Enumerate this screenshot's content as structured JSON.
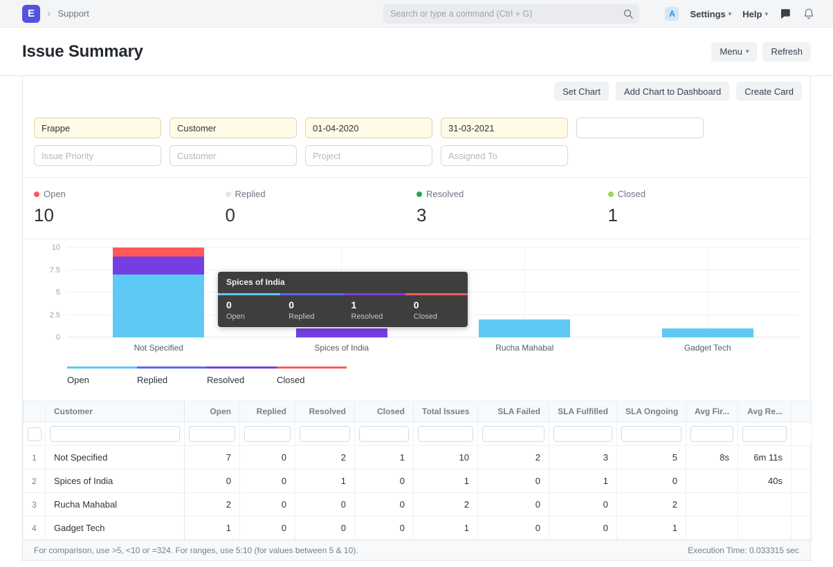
{
  "navbar": {
    "logo_letter": "E",
    "breadcrumb": "Support",
    "search_placeholder": "Search or type a command (Ctrl + G)",
    "shortcut_letter": "A",
    "settings_label": "Settings",
    "help_label": "Help"
  },
  "icons": {
    "chevron_right": "›",
    "caret_down": "▾"
  },
  "page": {
    "title": "Issue Summary",
    "menu_label": "Menu",
    "refresh_label": "Refresh"
  },
  "actions": {
    "set_chart": "Set Chart",
    "add_chart_to_dashboard": "Add Chart to Dashboard",
    "create_card": "Create Card"
  },
  "filters": {
    "row1": [
      {
        "value": "Frappe"
      },
      {
        "value": "Customer"
      },
      {
        "value": "01-04-2020"
      },
      {
        "value": "31-03-2021"
      },
      {
        "value": ""
      }
    ],
    "row2_placeholders": [
      "Issue Priority",
      "Customer",
      "Project",
      "Assigned To"
    ]
  },
  "stats": [
    {
      "label": "Open",
      "value": "10",
      "color": "#ff5858"
    },
    {
      "label": "Replied",
      "value": "0",
      "color": "#dce6ef"
    },
    {
      "label": "Resolved",
      "value": "3",
      "color": "#28a745"
    },
    {
      "label": "Closed",
      "value": "1",
      "color": "#98d85b"
    }
  ],
  "chart_data": {
    "type": "bar",
    "stacked": true,
    "categories": [
      "Not Specified",
      "Spices of India",
      "Rucha Mahabal",
      "Gadget Tech"
    ],
    "series": [
      {
        "name": "Open",
        "color": "#5ec9f5",
        "values": [
          7,
          0,
          2,
          1
        ]
      },
      {
        "name": "Replied",
        "color": "#5e64ff",
        "values": [
          0,
          0,
          0,
          0
        ]
      },
      {
        "name": "Resolved",
        "color": "#743ee2",
        "values": [
          2,
          1,
          0,
          0
        ]
      },
      {
        "name": "Closed",
        "color": "#ff5858",
        "values": [
          1,
          0,
          0,
          0
        ]
      }
    ],
    "yticks": [
      0,
      2.5,
      5,
      7.5,
      10
    ],
    "ylim": [
      0,
      10
    ],
    "legend_position": "bottom",
    "grid": true
  },
  "tooltip": {
    "title": "Spices of India",
    "items": [
      {
        "value": "0",
        "label": "Open"
      },
      {
        "value": "0",
        "label": "Replied"
      },
      {
        "value": "1",
        "label": "Resolved"
      },
      {
        "value": "0",
        "label": "Closed"
      }
    ]
  },
  "table": {
    "columns": [
      "Customer",
      "Open",
      "Replied",
      "Resolved",
      "Closed",
      "Total Issues",
      "SLA Failed",
      "SLA Fulfilled",
      "SLA Ongoing",
      "Avg Fir...",
      "Avg Re..."
    ],
    "rows": [
      {
        "idx": "1",
        "cells": [
          "Not Specified",
          "7",
          "0",
          "2",
          "1",
          "10",
          "2",
          "3",
          "5",
          "8s",
          "6m 11s"
        ]
      },
      {
        "idx": "2",
        "cells": [
          "Spices of India",
          "0",
          "0",
          "1",
          "0",
          "1",
          "0",
          "1",
          "0",
          "",
          "40s"
        ]
      },
      {
        "idx": "3",
        "cells": [
          "Rucha Mahabal",
          "2",
          "0",
          "0",
          "0",
          "2",
          "0",
          "0",
          "2",
          "",
          ""
        ]
      },
      {
        "idx": "4",
        "cells": [
          "Gadget Tech",
          "1",
          "0",
          "0",
          "0",
          "1",
          "0",
          "0",
          "1",
          "",
          ""
        ]
      }
    ],
    "footer_hint": "For comparison, use >5, <10 or =324. For ranges, use 5:10 (for values between 5 & 10).",
    "execution_time": "Execution Time: 0.033315 sec"
  }
}
